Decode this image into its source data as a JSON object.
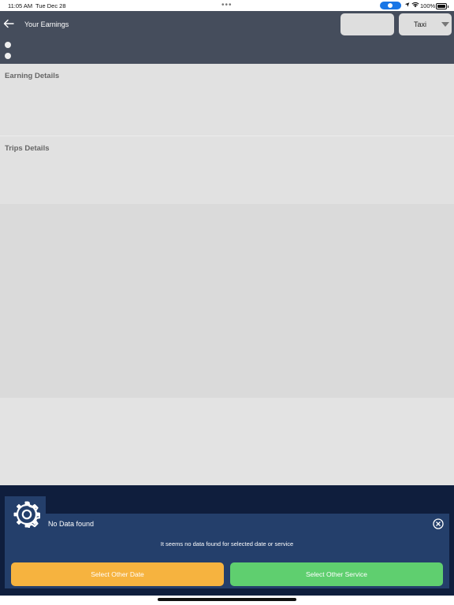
{
  "status_bar": {
    "time": "11:05 AM",
    "date": "Tue Dec 28",
    "battery_percent": "100%",
    "accent_pill": "#1976e6",
    "battery_level": 1.0
  },
  "header": {
    "title": "Your Earnings",
    "back_icon": "arrow-left-icon",
    "service_select": {
      "value": "Taxi",
      "icon": "caret-down-icon"
    },
    "background": "#454d5c"
  },
  "sections": {
    "earning_details": "Earning Details",
    "trips_details": "Trips Details"
  },
  "dialog": {
    "icon": "gear-icon",
    "title": "No Data found",
    "close_icon": "close-circle-icon",
    "message": "It seems no data found for selected date or service",
    "buttons": {
      "select_date": "Select Other Date",
      "select_service": "Select Other Service"
    },
    "colors": {
      "sheet": "#0f1e3d",
      "card": "#243f6b",
      "date_button": "#f6b33f",
      "service_button": "#5fcf6f"
    }
  }
}
